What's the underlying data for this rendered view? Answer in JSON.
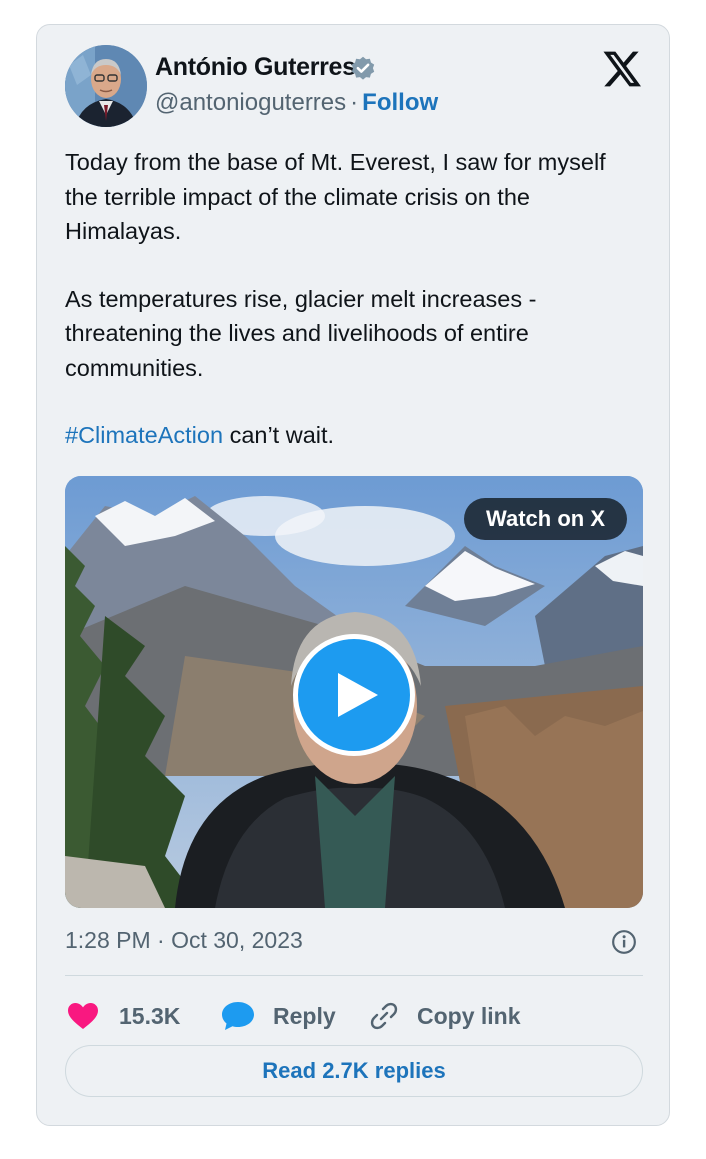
{
  "author": {
    "name": "António Guterres",
    "handle": "@antonioguterres",
    "separator": "·",
    "follow_label": "Follow",
    "verified": true
  },
  "tweet": {
    "paragraph_1": "Today from the base of Mt. Everest, I saw for myself the terrible impact of the climate crisis on the Himalayas.",
    "paragraph_2": "As temperatures rise, glacier melt increases - threatening the lives and livelihoods of entire communities.",
    "hashtag": "#ClimateAction",
    "closing": " can’t wait."
  },
  "media": {
    "watch_label": "Watch on X",
    "play_icon": "play-icon"
  },
  "meta": {
    "timestamp": "1:28 PM · Oct 30, 2023"
  },
  "actions": {
    "likes": "15.3K",
    "reply_label": "Reply",
    "copy_label": "Copy link",
    "read_replies_label": "Read 2.7K replies"
  },
  "colors": {
    "card_bg": "#eef1f4",
    "link_blue": "#1d74bb",
    "play_blue": "#1d9bf0",
    "like_pink": "#f91880",
    "muted_text": "#536471"
  }
}
